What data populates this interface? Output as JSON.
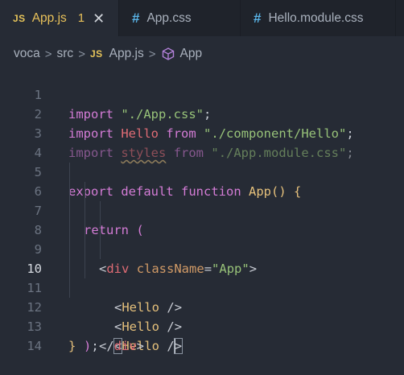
{
  "tabs": [
    {
      "icon": "JS",
      "label": "App.js",
      "badge": "1",
      "close": "✕"
    },
    {
      "icon": "#",
      "label": "App.css"
    },
    {
      "icon": "#",
      "label": "Hello.module.css"
    }
  ],
  "breadcrumb": {
    "folder1": "voca",
    "folder2": "src",
    "file_icon": "JS",
    "file": "App.js",
    "symbol": "App",
    "separator": ">"
  },
  "editor": {
    "current_line": 10,
    "lines": [
      {
        "n": "1"
      },
      {
        "n": "2"
      },
      {
        "n": "3"
      },
      {
        "n": "4"
      },
      {
        "n": "5"
      },
      {
        "n": "6"
      },
      {
        "n": "7"
      },
      {
        "n": "8"
      },
      {
        "n": "9"
      },
      {
        "n": "10"
      },
      {
        "n": "11"
      },
      {
        "n": "12"
      },
      {
        "n": "13"
      },
      {
        "n": "14"
      }
    ],
    "tokens": {
      "import": "import",
      "from": "from",
      "app_css": "\"./App.css\"",
      "semicolon": ";",
      "hello": "Hello",
      "hello_path": "\"./component/Hello\"",
      "styles": "styles",
      "module_css": "\"./App.module.css\"",
      "export": "export",
      "default": "default",
      "function": "function",
      "app": "App",
      "parens": "()",
      "brace_open": "{",
      "brace_close": "}",
      "return": "return",
      "paren_open": "(",
      "paren_close": ")",
      "lt": "<",
      "gt": ">",
      "div": "div",
      "classname": "className",
      "eq": "=",
      "app_str": "\"App\"",
      "self_close": "/>",
      "close_slash": "</"
    }
  }
}
